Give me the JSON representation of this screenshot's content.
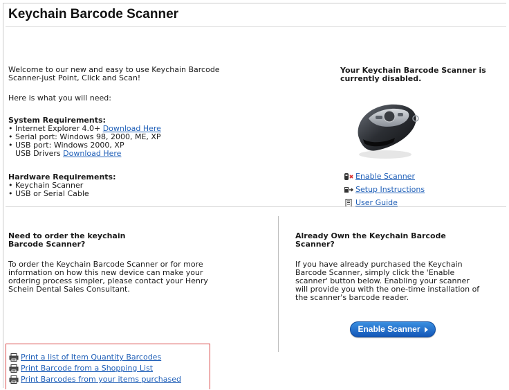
{
  "header": {
    "title": "Keychain Barcode Scanner"
  },
  "intro": {
    "welcome_line1": "Welcome to our new and easy to use Keychain Barcode",
    "welcome_line2": "Scanner-just Point, Click and Scan!",
    "need_text": "Here is what you will need:"
  },
  "system_requirements": {
    "heading": "System Requirements:",
    "item1_text": "Internet Explorer 4.0+ ",
    "item1_link": "Download Here",
    "item2_text": "Serial port: Windows 98, 2000, ME, XP",
    "item3_text": "USB port: Windows 2000, XP",
    "item3b_text": "USB Drivers ",
    "item3b_link": "Download Here"
  },
  "hardware_requirements": {
    "heading": "Hardware Requirements:",
    "item1": "Keychain Scanner",
    "item2": "USB or Serial Cable"
  },
  "status": {
    "line1": "Your Keychain Barcode Scanner is",
    "line2": "currently disabled."
  },
  "right_links": {
    "enable": "Enable Scanner",
    "setup": "Setup Instructions",
    "guide": "User Guide"
  },
  "order": {
    "heading_line1": "Need to order the keychain",
    "heading_line2": "Barcode Scanner?",
    "body_line1": "To order the Keychain Barcode Scanner or for more",
    "body_line2": "information on how this new device can make your",
    "body_line3": "ordering process simpler, please contact your Henry",
    "body_line4": "Schein Dental Sales Consultant."
  },
  "own": {
    "heading_line1": "Already Own the Keychain Barcode",
    "heading_line2": "Scanner?",
    "body_line1": "If you have already purchased the Keychain",
    "body_line2": "Barcode Scanner, simply click the 'Enable",
    "body_line3": "scanner' button below. Enabling your scanner",
    "body_line4": "will provide you with the one-time installation of",
    "body_line5": "the scanner's barcode reader.",
    "button_label": "Enable Scanner"
  },
  "print_links": {
    "item1": "Print a list of Item Quantity Barcodes",
    "item2": "Print Barcode from a Shopping List",
    "item3": "Print Barcodes from your items purchased"
  },
  "colors": {
    "link": "#1f5fb8",
    "button": "#1a67c8",
    "highlight_border": "#d94545"
  }
}
